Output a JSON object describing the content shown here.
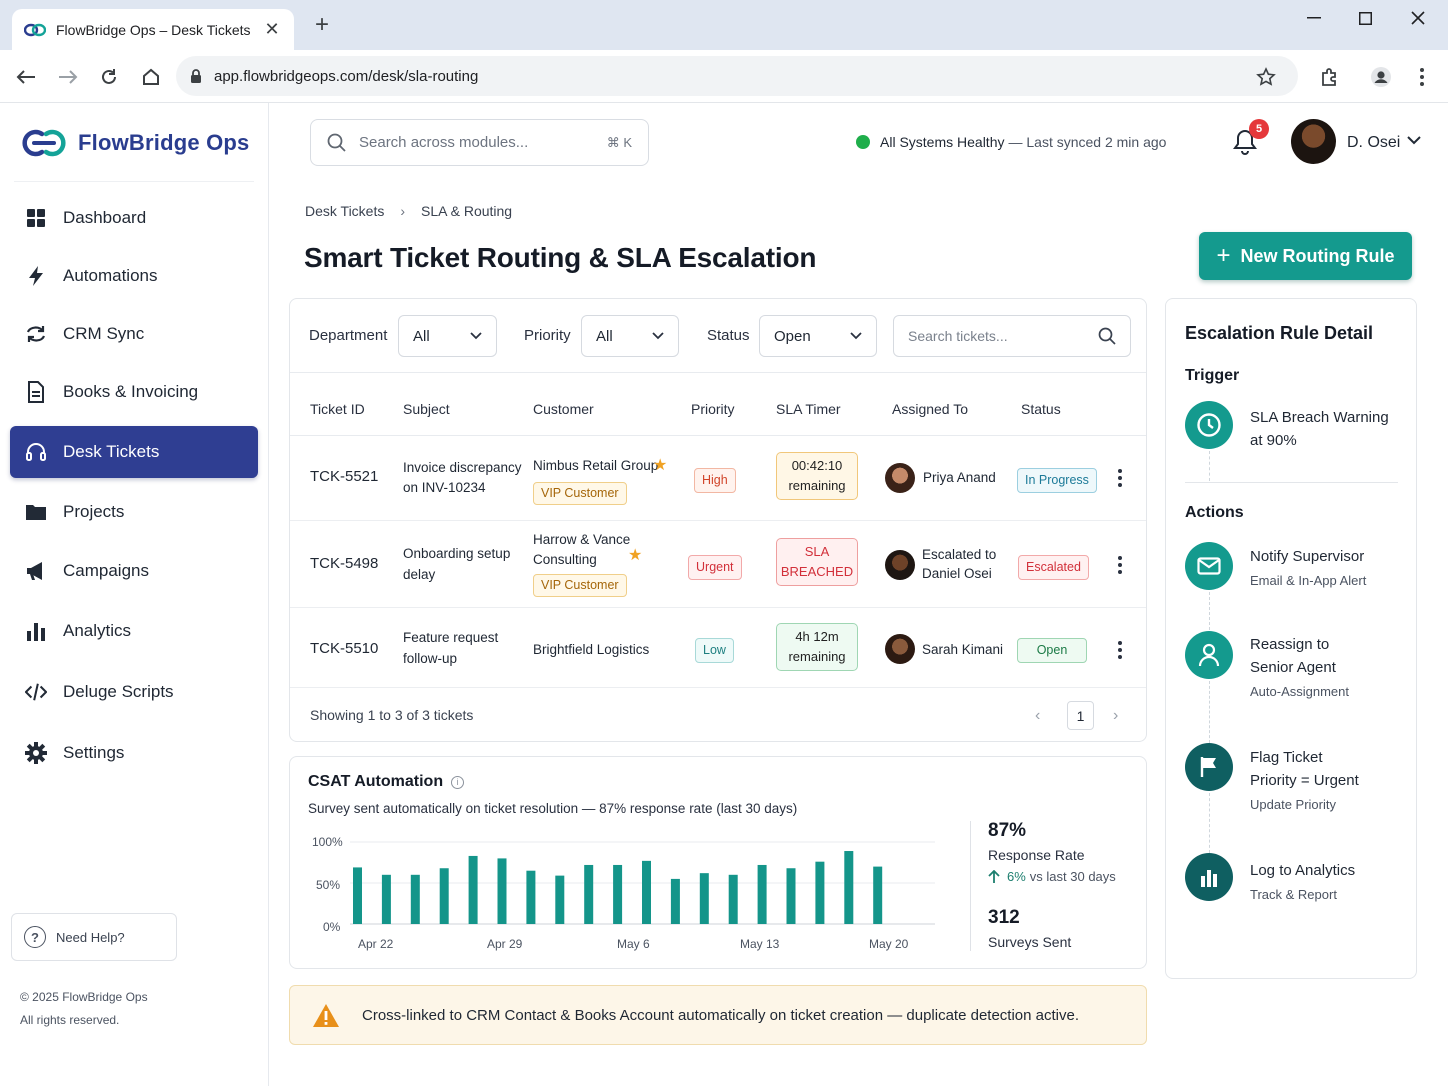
{
  "browser": {
    "tab_title": "FlowBridge Ops – Desk Tickets",
    "url": "app.flowbridgeops.com/desk/sla-routing"
  },
  "sidebar": {
    "brand": "FlowBridge Ops",
    "items": [
      {
        "label": "Dashboard",
        "icon": "grid-icon"
      },
      {
        "label": "Automations",
        "icon": "bolt-icon"
      },
      {
        "label": "CRM Sync",
        "icon": "sync-icon"
      },
      {
        "label": "Books & Invoicing",
        "icon": "document-icon"
      },
      {
        "label": "Desk Tickets",
        "icon": "headset-icon",
        "active": true
      },
      {
        "label": "Projects",
        "icon": "folder-icon"
      },
      {
        "label": "Campaigns",
        "icon": "megaphone-icon"
      },
      {
        "label": "Analytics",
        "icon": "bar-chart-icon"
      },
      {
        "label": "Deluge Scripts",
        "icon": "code-icon"
      },
      {
        "label": "Settings",
        "icon": "gear-icon"
      }
    ],
    "help": "Need Help?",
    "copyright": "© 2025 FlowBridge Ops",
    "rights": "All rights reserved."
  },
  "header": {
    "search_placeholder": "Search across modules...",
    "shortcut": "⌘ K",
    "health_status": "All Systems Healthy",
    "health_sub": "— Last synced 2 min ago",
    "notifications": "5",
    "user": "D. Osei"
  },
  "breadcrumb": {
    "parent": "Desk Tickets",
    "current": "SLA & Routing"
  },
  "page_title": "Smart Ticket Routing & SLA Escalation",
  "new_rule_button": "New Routing Rule",
  "filters": {
    "department_label": "Department",
    "department_value": "All",
    "priority_label": "Priority",
    "priority_value": "All",
    "status_label": "Status",
    "status_value": "Open",
    "search_placeholder": "Search tickets..."
  },
  "table": {
    "columns": [
      "Ticket ID",
      "Subject",
      "Customer",
      "Priority",
      "SLA Timer",
      "Assigned To",
      "Status"
    ],
    "rows": [
      {
        "id": "TCK-5521",
        "subject1": "Invoice discrepancy",
        "subject2": "on INV-10234",
        "customer1": "Nimbus Retail Group",
        "customer2": "",
        "vip": "VIP Customer",
        "priority": "High",
        "sla1": "00:42:10",
        "sla2": "remaining",
        "assignee1": "Priya Anand",
        "assignee2": "",
        "status": "In Progress"
      },
      {
        "id": "TCK-5498",
        "subject1": "Onboarding setup",
        "subject2": "delay",
        "customer1": "Harrow & Vance",
        "customer2": "Consulting",
        "vip": "VIP Customer",
        "priority": "Urgent",
        "sla1": "SLA",
        "sla2": "BREACHED",
        "assignee1": "Escalated to",
        "assignee2": "Daniel Osei",
        "status": "Escalated"
      },
      {
        "id": "TCK-5510",
        "subject1": "Feature request",
        "subject2": "follow-up",
        "customer1": "Brightfield Logistics",
        "customer2": "",
        "vip": "",
        "priority": "Low",
        "sla1": "4h 12m",
        "sla2": "remaining",
        "assignee1": "Sarah Kimani",
        "assignee2": "",
        "status": "Open"
      }
    ],
    "footer": "Showing 1 to 3 of 3 tickets",
    "page": "1"
  },
  "csat": {
    "title": "CSAT Automation",
    "subtitle": "Survey sent automatically on ticket resolution — 87% response rate (last 30 days)",
    "kpi_rate": "87%",
    "kpi_rate_label": "Response Rate",
    "kpi_delta": "6%",
    "kpi_delta_label": "vs last 30 days",
    "kpi_sent": "312",
    "kpi_sent_label": "Surveys Sent"
  },
  "chart_data": {
    "type": "bar",
    "ylim": [
      0,
      100
    ],
    "yticks": [
      "100%",
      "50%",
      "0%"
    ],
    "xticks": [
      "Apr 22",
      "Apr 29",
      "May 6",
      "May 13",
      "May 20"
    ],
    "values": [
      69,
      60,
      60,
      68,
      83,
      80,
      65,
      59,
      72,
      72,
      77,
      55,
      62,
      60,
      72,
      68,
      76,
      89,
      70
    ],
    "color": "#14958a",
    "grid": true
  },
  "alert": "Cross-linked to CRM Contact & Books Account automatically on ticket creation — duplicate detection active.",
  "rule_detail": {
    "title": "Escalation Rule Detail",
    "trigger_heading": "Trigger",
    "trigger_line1": "SLA Breach Warning",
    "trigger_line2": "at 90%",
    "actions_heading": "Actions",
    "actions": [
      {
        "line1": "Notify Supervisor",
        "line2": "",
        "sub": "Email & In-App Alert",
        "icon": "envelope-icon"
      },
      {
        "line1": "Reassign to",
        "line2": "Senior Agent",
        "sub": "Auto-Assignment",
        "icon": "user-icon"
      },
      {
        "line1": "Flag Ticket",
        "line2": "Priority = Urgent",
        "sub": "Update Priority",
        "icon": "flag-icon"
      },
      {
        "line1": "Log to Analytics",
        "line2": "",
        "sub": "Track & Report",
        "icon": "bar-chart-icon"
      }
    ],
    "icon_color": "#149a8e",
    "dark_icon_color": "#0f5f61"
  }
}
